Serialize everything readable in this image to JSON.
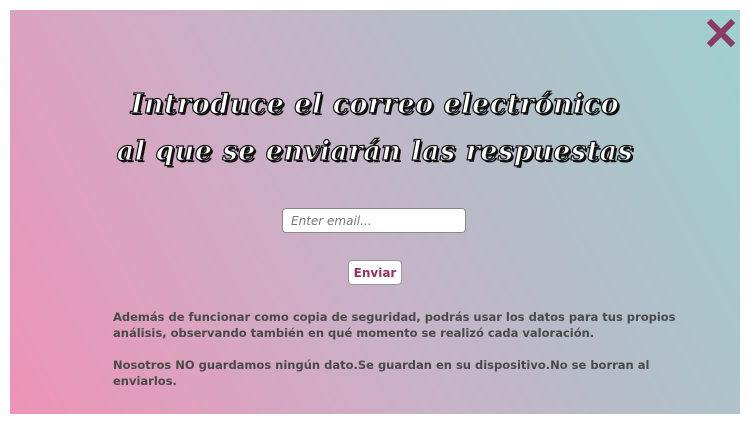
{
  "dialog": {
    "title_line1": "Introduce el correo electrónico",
    "title_line2": "al que se enviarán las respuestas",
    "email_placeholder": "Enter email...",
    "send_label": "Enviar",
    "info_paragraph1": "Además de funcionar como copia de seguridad, podrás usar los datos para tus propios análisis, observando también en qué momento se realizó cada valoración.",
    "info_paragraph2": "Nosotros NO guardamos ningún dato.Se guardan en su dispositivo.No se borran al enviarlos.",
    "close_icon": "close-x-icon",
    "close_color": "#8b3a62"
  }
}
